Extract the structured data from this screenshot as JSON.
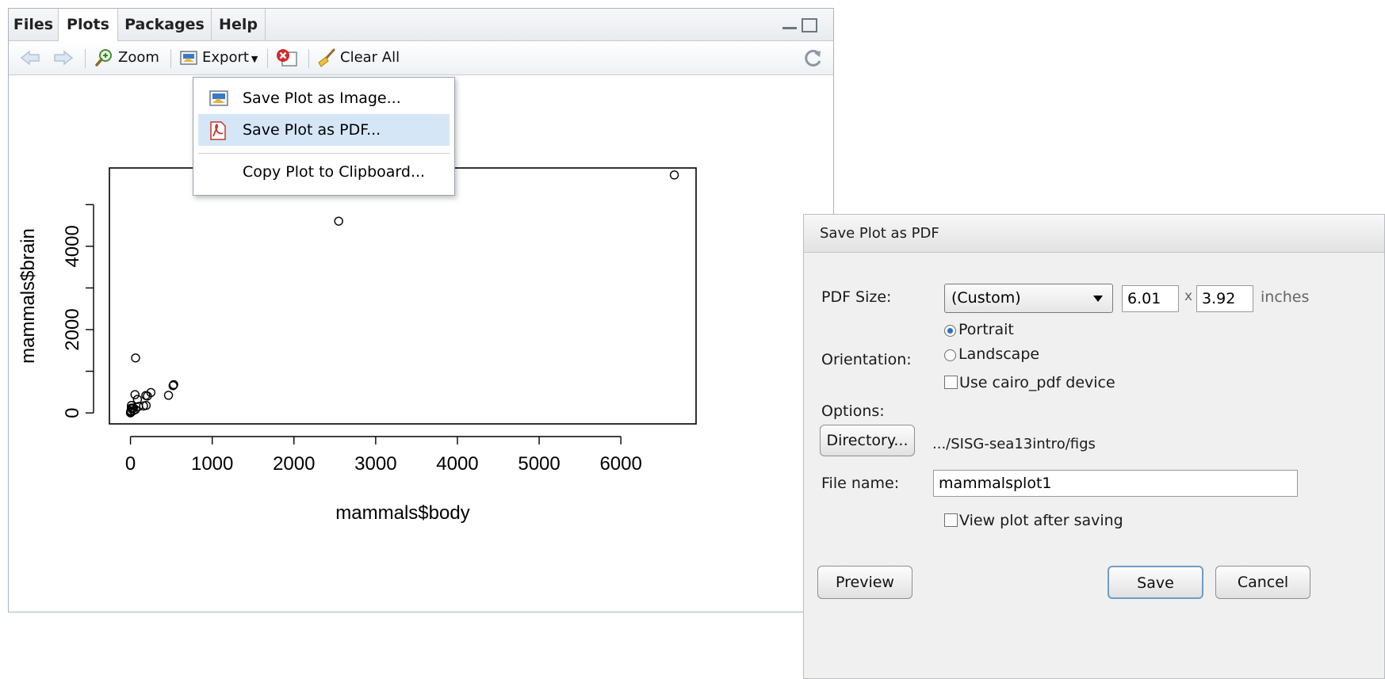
{
  "tabs": [
    {
      "label": "Files",
      "active": false
    },
    {
      "label": "Plots",
      "active": true
    },
    {
      "label": "Packages",
      "active": false
    },
    {
      "label": "Help",
      "active": false
    }
  ],
  "toolbar": {
    "back_icon": "arrow-left-icon",
    "forward_icon": "arrow-right-icon",
    "zoom_label": "Zoom",
    "export_label": "Export",
    "remove_icon": "remove-plot-icon",
    "clear_all_label": "Clear All",
    "refresh_icon": "refresh-icon"
  },
  "export_menu": {
    "items": [
      {
        "label": "Save Plot as Image...",
        "icon": "image-icon"
      },
      {
        "label": "Save Plot as PDF...",
        "icon": "pdf-icon",
        "highlighted": true
      },
      {
        "label": "Copy Plot to Clipboard..."
      }
    ]
  },
  "chart_data": {
    "type": "scatter",
    "title": "",
    "xlabel": "mammals$body",
    "ylabel": "mammals$brain",
    "xlim": [
      -258,
      6920
    ],
    "ylim": [
      -263,
      5880
    ],
    "xticks": [
      0,
      1000,
      2000,
      3000,
      4000,
      5000,
      6000
    ],
    "xtick_labels": [
      "0",
      "1000",
      "2000",
      "3000",
      "4000",
      "5000",
      "6000"
    ],
    "yticks": [
      0,
      2000,
      4000
    ],
    "ytick_labels": [
      "0",
      "2000",
      "4000"
    ],
    "yticks_minor": [
      1000,
      3000,
      5000
    ],
    "points": [
      [
        6654,
        5712
      ],
      [
        2547,
        4603
      ],
      [
        62,
        1320
      ],
      [
        529,
        680
      ],
      [
        521,
        655
      ],
      [
        465,
        423
      ],
      [
        250,
        490
      ],
      [
        187,
        419
      ],
      [
        207,
        406
      ],
      [
        192,
        180
      ],
      [
        160,
        169
      ],
      [
        100,
        157
      ],
      [
        85,
        325
      ],
      [
        55,
        440
      ],
      [
        36,
        119
      ],
      [
        27,
        115
      ],
      [
        35,
        56
      ],
      [
        14,
        98
      ],
      [
        10,
        115
      ],
      [
        6,
        50
      ],
      [
        3,
        25
      ],
      [
        1,
        6
      ],
      [
        0.1,
        4
      ],
      [
        2,
        12
      ],
      [
        4,
        40
      ],
      [
        0.5,
        3
      ],
      [
        1.4,
        12.5
      ],
      [
        60,
        81
      ],
      [
        10.5,
        179
      ],
      [
        27.7,
        115
      ]
    ],
    "marker": "open-circle",
    "grid": false
  },
  "dialog": {
    "title": "Save Plot as PDF",
    "pdf_size_label": "PDF Size:",
    "pdf_size_value": "(Custom)",
    "width_value": "6.01",
    "x_label": "x",
    "height_value": "3.92",
    "units_label": "inches",
    "orientation_label": "Orientation:",
    "portrait_label": "Portrait",
    "landscape_label": "Landscape",
    "orientation_selected": "Portrait",
    "options_label": "Options:",
    "cairo_label": "Use cairo_pdf device",
    "cairo_checked": false,
    "directory_button": "Directory...",
    "directory_path": ".../SISG-sea13intro/figs",
    "file_name_label": "File name:",
    "file_name_value": "mammalsplot1",
    "view_after_label": "View plot after saving",
    "view_after_checked": false,
    "preview_button": "Preview",
    "save_button": "Save",
    "cancel_button": "Cancel"
  }
}
